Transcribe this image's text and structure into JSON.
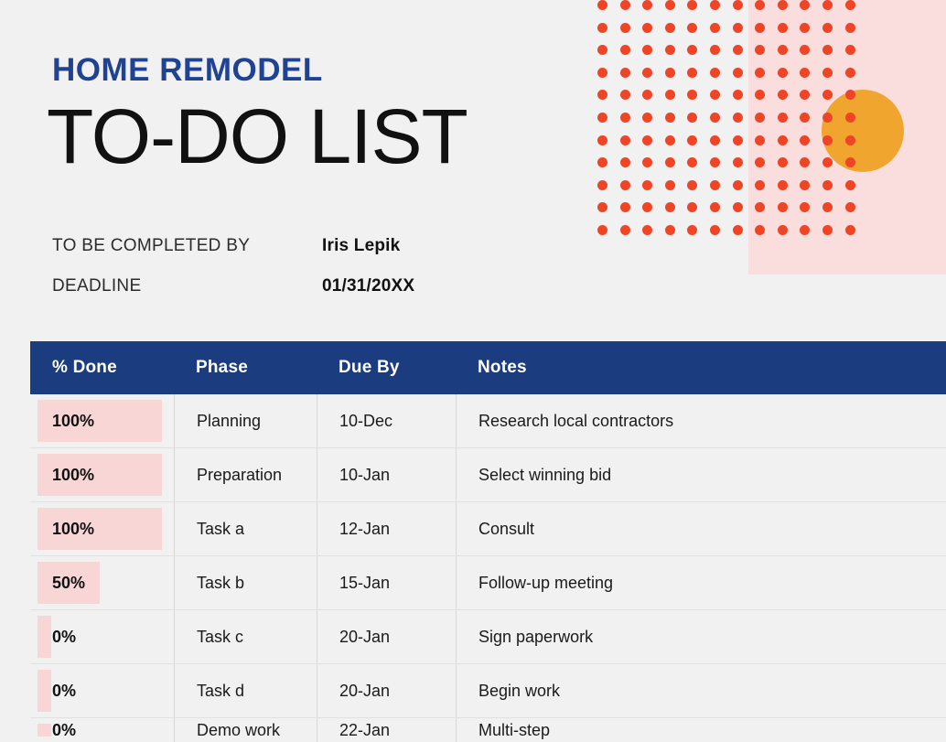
{
  "document": {
    "eyebrow": "HOME REMODEL",
    "title": "TO-DO LIST",
    "accent_blue": "#1f4293",
    "header_navy": "#1b3d7f",
    "progress_pink": "#f9d6d6",
    "dot_red": "#ef4426",
    "circle_orange": "#f0a62e",
    "panel_pink": "#fadddd",
    "page_background": "#f2f1f1"
  },
  "meta": [
    {
      "label": "TO BE COMPLETED BY",
      "value": "Iris Lepik"
    },
    {
      "label": "DEADLINE",
      "value": "01/31/20XX"
    }
  ],
  "table": {
    "columns": [
      "% Done",
      "Phase",
      "Due By",
      "Notes"
    ],
    "rows": [
      {
        "percent": "100%",
        "value": 100,
        "phase": "Planning",
        "due": "10-Dec",
        "notes": "Research local contractors"
      },
      {
        "percent": "100%",
        "value": 100,
        "phase": "Preparation",
        "due": "10-Jan",
        "notes": "Select winning bid"
      },
      {
        "percent": "100%",
        "value": 100,
        "phase": "Task a",
        "due": "12-Jan",
        "notes": "Consult"
      },
      {
        "percent": "50%",
        "value": 50,
        "phase": "Task b",
        "due": "15-Jan",
        "notes": "Follow-up meeting"
      },
      {
        "percent": "0%",
        "value": 0,
        "phase": "Task c",
        "due": "20-Jan",
        "notes": "Sign paperwork"
      },
      {
        "percent": "0%",
        "value": 0,
        "phase": "Task d",
        "due": "20-Jan",
        "notes": "Begin work"
      },
      {
        "percent": "0%",
        "value": 0,
        "phase": "Demo work",
        "due": "22-Jan",
        "notes": "Multi-step"
      }
    ]
  },
  "decoration": {
    "dot_columns": 12,
    "dot_rows": 11
  }
}
